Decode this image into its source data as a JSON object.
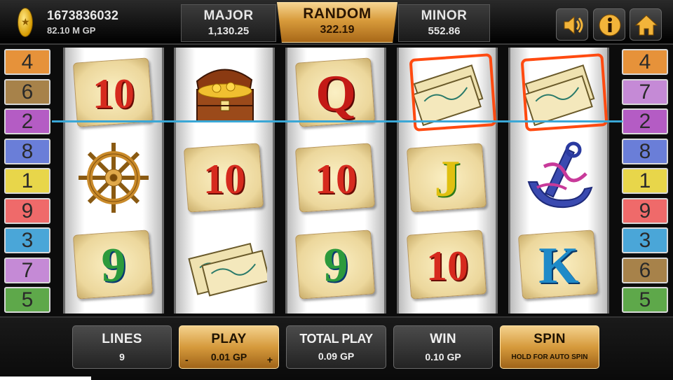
{
  "account": {
    "id": "1673836032",
    "balance": "82.10 M GP",
    "coin_icon": "star-coin-icon"
  },
  "jackpots": {
    "major": {
      "label": "MAJOR",
      "value": "1,130.25"
    },
    "random": {
      "label": "RANDOM",
      "value": "322.19"
    },
    "minor": {
      "label": "MINOR",
      "value": "552.86"
    }
  },
  "top_buttons": {
    "sound_icon": "speaker-icon",
    "info_icon": "info-icon",
    "home_icon": "home-icon"
  },
  "paylines_left": [
    "4",
    "6",
    "2",
    "8",
    "1",
    "9",
    "3",
    "7",
    "5"
  ],
  "paylines_right": [
    "4",
    "7",
    "2",
    "8",
    "1",
    "9",
    "3",
    "6",
    "5"
  ],
  "payline_colors": [
    "#e8d64a",
    "#b45cc4",
    "#4aa6d8",
    "#e6923a",
    "#5ea84a",
    "#a7824a",
    "#c58ad6",
    "#6a7ed8",
    "#ef6a6a"
  ],
  "reels": [
    [
      "10",
      "ship-wheel",
      "9"
    ],
    [
      "treasure-chest",
      "10",
      "map"
    ],
    [
      "Q",
      "10",
      "9"
    ],
    [
      "map",
      "J",
      "10"
    ],
    [
      "map",
      "anchor",
      "K"
    ]
  ],
  "winning_line": "2",
  "controls": {
    "lines": {
      "label": "LINES",
      "value": "9"
    },
    "play": {
      "label": "PLAY",
      "value": "0.01 GP",
      "minus": "-",
      "plus": "+"
    },
    "total_play": {
      "label": "TOTAL PLAY",
      "value": "0.09 GP"
    },
    "win": {
      "label": "WIN",
      "value": "0.10 GP"
    },
    "spin": {
      "label": "SPIN",
      "hint": "HOLD FOR AUTO SPIN"
    }
  }
}
